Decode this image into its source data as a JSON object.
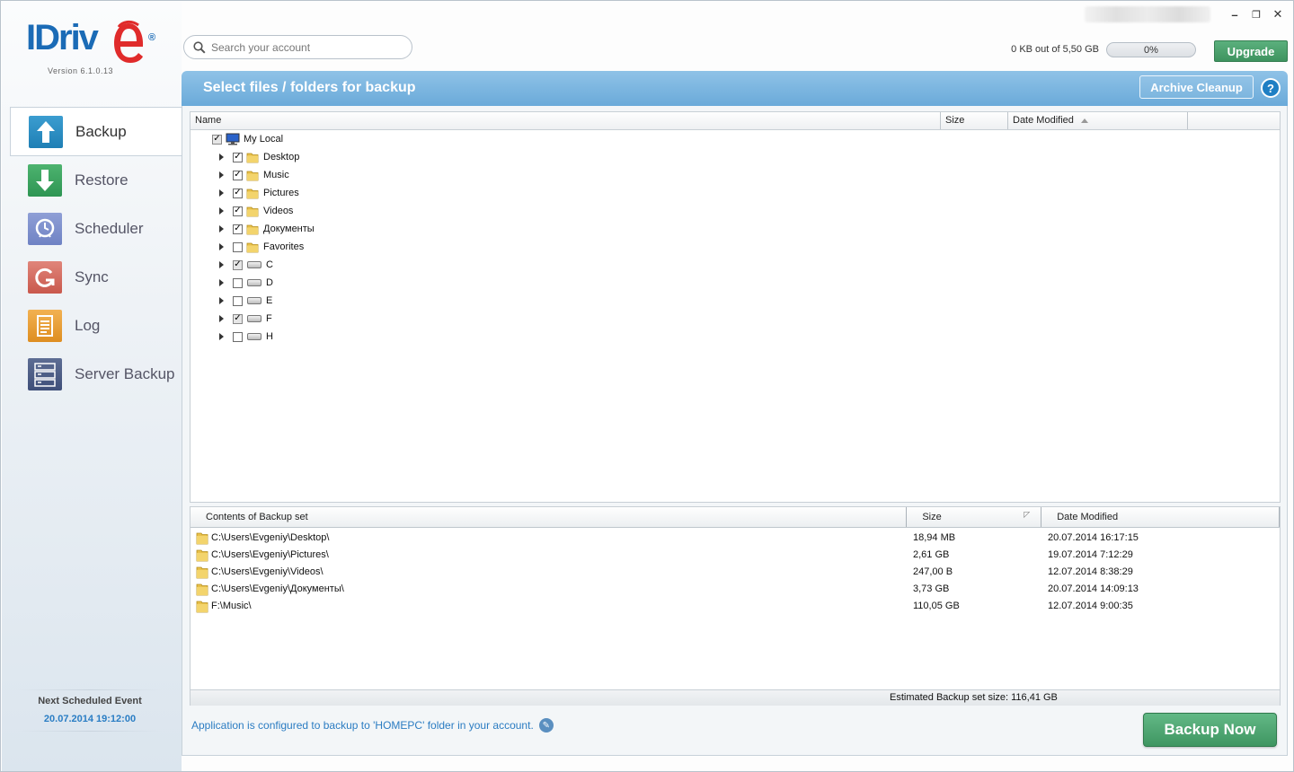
{
  "app": {
    "logo_text": "IDriv",
    "version": "Version  6.1.0.13"
  },
  "window_controls": {
    "minimize": "–",
    "restore": "❐",
    "close": "✕"
  },
  "search": {
    "placeholder": "Search your account"
  },
  "quota": {
    "text": "0 KB out of 5,50 GB",
    "percent_label": "0%",
    "fraction": 0.0
  },
  "upgrade_label": "Upgrade",
  "sidebar": {
    "items": [
      {
        "label": "Backup",
        "icon": "upload-arrow-icon",
        "active": true
      },
      {
        "label": "Restore",
        "icon": "download-arrow-icon",
        "active": false
      },
      {
        "label": "Scheduler",
        "icon": "clock-icon",
        "active": false
      },
      {
        "label": "Sync",
        "icon": "sync-icon",
        "active": false
      },
      {
        "label": "Log",
        "icon": "log-icon",
        "active": false
      },
      {
        "label": "Server Backup",
        "icon": "server-icon",
        "active": false
      }
    ],
    "next_event_title": "Next Scheduled Event",
    "next_event_time": "20.07.2014 19:12:00"
  },
  "header": {
    "title": "Select files / folders for backup",
    "archive_cleanup": "Archive Cleanup",
    "help": "?"
  },
  "tree": {
    "columns": {
      "name": "Name",
      "size": "Size",
      "date": "Date Modified"
    },
    "root": {
      "label": "My Local",
      "checked": "partial"
    },
    "items": [
      {
        "label": "Desktop",
        "type": "folder",
        "checked": "checked"
      },
      {
        "label": "Music",
        "type": "folder",
        "checked": "checked"
      },
      {
        "label": "Pictures",
        "type": "folder",
        "checked": "checked"
      },
      {
        "label": "Videos",
        "type": "folder",
        "checked": "checked"
      },
      {
        "label": "Документы",
        "type": "folder",
        "checked": "checked"
      },
      {
        "label": "Favorites",
        "type": "folder",
        "checked": "unchecked"
      },
      {
        "label": "C",
        "type": "drive",
        "checked": "partial"
      },
      {
        "label": "D",
        "type": "drive",
        "checked": "unchecked"
      },
      {
        "label": "E",
        "type": "drive",
        "checked": "unchecked"
      },
      {
        "label": "F",
        "type": "drive",
        "checked": "partial"
      },
      {
        "label": "H",
        "type": "drive",
        "checked": "unchecked"
      }
    ]
  },
  "contents": {
    "columns": {
      "name": "Contents of Backup set",
      "size": "Size",
      "date": "Date Modified"
    },
    "rows": [
      {
        "path": "C:\\Users\\Evgeniy\\Desktop\\",
        "size": "18,94 MB",
        "date": "20.07.2014 16:17:15"
      },
      {
        "path": "C:\\Users\\Evgeniy\\Pictures\\",
        "size": "2,61 GB",
        "date": "19.07.2014 7:12:29"
      },
      {
        "path": "C:\\Users\\Evgeniy\\Videos\\",
        "size": "247,00 B",
        "date": "12.07.2014 8:38:29"
      },
      {
        "path": "C:\\Users\\Evgeniy\\Документы\\",
        "size": "3,73 GB",
        "date": "20.07.2014 14:09:13"
      },
      {
        "path": "F:\\Music\\",
        "size": "110,05 GB",
        "date": "12.07.2014 9:00:35"
      }
    ],
    "estimated": "Estimated Backup set size: 116,41 GB"
  },
  "footer": {
    "note": "Application is configured to backup to 'HOMEPC' folder in your account.",
    "backup_now": "Backup Now"
  }
}
